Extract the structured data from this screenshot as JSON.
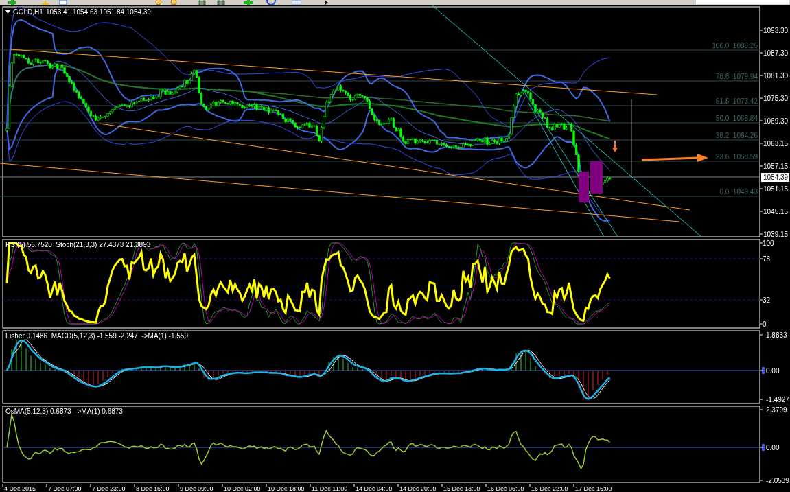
{
  "chart": {
    "symbol": "GOLD,H1",
    "ohlc": "1053.41 1054.63 1051.84 1054.39",
    "price_axis": [
      "1093.30",
      "1087.30",
      "1081.30",
      "1075.30",
      "1069.30",
      "1063.15",
      "1057.15",
      "1051.15",
      "1045.15",
      "1039.15"
    ],
    "current_price": "1054.39",
    "fibonacci_levels": [
      {
        "level": "100.0",
        "price": "1088.25"
      },
      {
        "level": "78.6",
        "price": "1079.94"
      },
      {
        "level": "61.8",
        "price": "1073.42"
      },
      {
        "level": "50.0",
        "price": "1068.84"
      },
      {
        "level": "38.2",
        "price": "1064.26"
      },
      {
        "level": "23.6",
        "price": "1058.59"
      },
      {
        "level": "0.0",
        "price": "1049.43"
      }
    ]
  },
  "rsi_pane": {
    "legend": "RSI(5) 56.7520  Stoch(21,3,3) 27.4373 21.3893",
    "axis": [
      "100",
      "78",
      "32",
      "0"
    ]
  },
  "macd_pane": {
    "legend": "Fisher 0.1486  MACD(5,12,3) -1.559 -2.247  ->MA(1) -1.559",
    "axis": [
      "1.8833",
      "0.00",
      "-1.4927"
    ]
  },
  "osma_pane": {
    "legend": "OsMA(5,12,3) 0.6873  ->MA(1) 0.6873",
    "axis": [
      "2.3799",
      "0.00",
      "-2.0539"
    ]
  },
  "time_axis": [
    "4 Dec 2015",
    "7 Dec 07:00",
    "7 Dec 23:00",
    "8 Dec 16:00",
    "9 Dec 09:00",
    "10 Dec 02:00",
    "10 Dec 18:00",
    "11 Dec 11:00",
    "14 Dec 04:00",
    "14 Dec 20:00",
    "15 Dec 13:00",
    "16 Dec 06:00",
    "16 Dec 22:00",
    "17 Dec 15:00"
  ]
}
